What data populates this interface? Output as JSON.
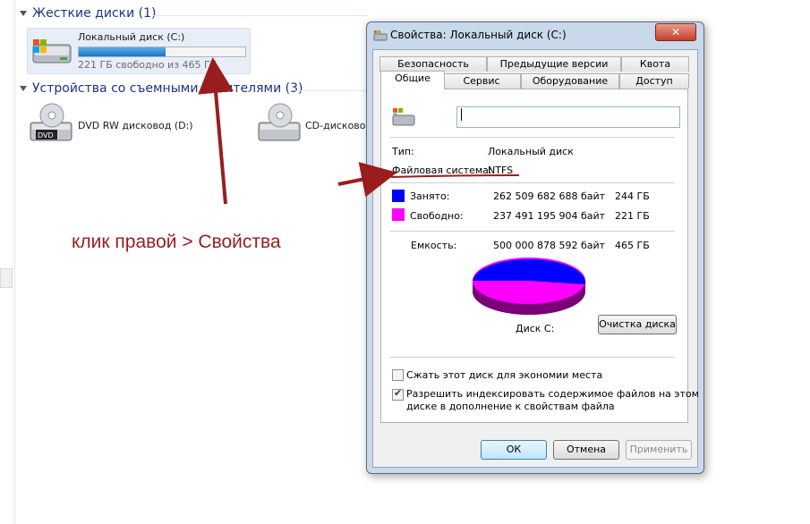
{
  "explorer": {
    "hard_drives_header": "Жесткие диски (1)",
    "removable_header": "Устройства со съемными носителями (3)",
    "local_disk": {
      "name": "Локальный диск (C:)",
      "free_text": "221 ГБ свободно из 465 ГБ",
      "used_fraction": 0.52
    },
    "dvd_drive": {
      "name": "DVD RW дисковод (D:)",
      "icon_text": "DVD"
    },
    "cd_drive": {
      "name": "CD-дисково"
    }
  },
  "annotation": {
    "text": "клик правой > Свойства",
    "color": "#9a1d1d"
  },
  "dialog": {
    "title": "Свойства: Локальный диск (C:)",
    "close_label": "✕",
    "tabs_row1": [
      "Безопасность",
      "Предыдущие версии",
      "Квота"
    ],
    "tabs_row2": [
      "Общие",
      "Сервис",
      "Оборудование",
      "Доступ"
    ],
    "active_tab": "Общие",
    "name_value": "",
    "type_label": "Тип:",
    "type_value": "Локальный диск",
    "fs_label": "Файловая система:",
    "fs_value": "NTFS",
    "used": {
      "label": "Занято:",
      "bytes": "262 509 682 688 байт",
      "size": "244 ГБ",
      "color": "#0000ff"
    },
    "free": {
      "label": "Свободно:",
      "bytes": "237 491 195 904 байт",
      "size": "221 ГБ",
      "color": "#ff00ff"
    },
    "capacity": {
      "label": "Емкость:",
      "bytes": "500 000 878 592 байт",
      "size": "465 ГБ"
    },
    "disk_label": "Диск C:",
    "cleanup_button": "Очистка диска",
    "compress_label": "Сжать этот диск для экономии места",
    "compress_checked": false,
    "index_label_line1": "Разрешить индексировать содержимое файлов на этом",
    "index_label_line2": "диске в дополнение к свойствам файла",
    "index_checked": true,
    "ok_button": "ОК",
    "cancel_button": "Отмена",
    "apply_button": "Применить"
  }
}
